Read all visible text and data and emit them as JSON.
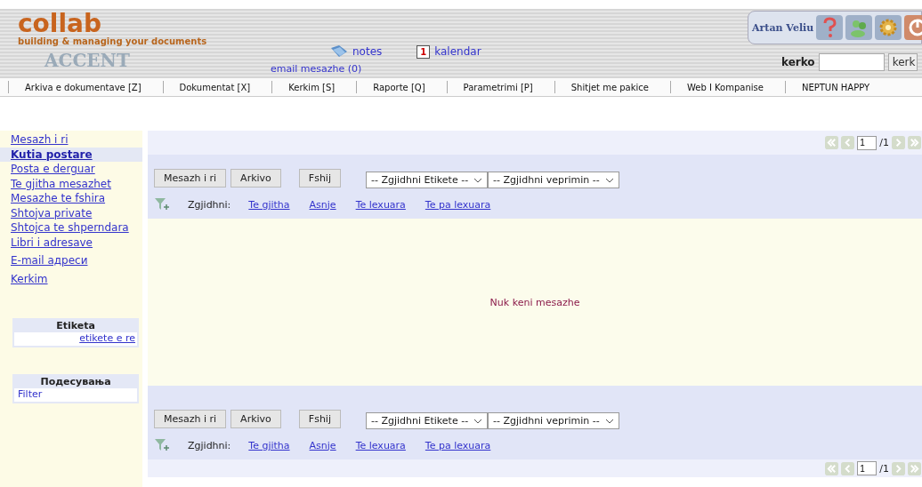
{
  "header": {
    "logo": {
      "name": "collab",
      "tagline": "building & managing your documents",
      "brand": "ACCENT"
    },
    "email_link": "email mesazhe (0)",
    "notes_link": "notes",
    "calendar_link": "kalendar",
    "calendar_day": "1",
    "user": "Artan Veliu",
    "search": {
      "label": "kerko",
      "button": "kerk"
    }
  },
  "menu": [
    "Arkiva e dokumentave [Z]",
    "Dokumentat [X]",
    "Kerkim [S]",
    "Raporte [Q]",
    "Parametrimi [P]",
    "Shitjet me pakice",
    "Web I Kompanise",
    "NEPTUN HAPPY"
  ],
  "sidebar": {
    "items": [
      {
        "label": "Mesazh i ri",
        "selected": false
      },
      {
        "label": "Kutia postare",
        "selected": true
      },
      {
        "label": "Posta e derguar",
        "selected": false
      },
      {
        "label": "Te gjitha mesazhet",
        "selected": false
      },
      {
        "label": "Mesazhe te fshira",
        "selected": false
      },
      {
        "label": "Shtojva private",
        "selected": false
      },
      {
        "label": "Shtojca te shperndara",
        "selected": false
      },
      {
        "label": "Libri i adresave",
        "selected": false
      }
    ],
    "extra_items": [
      "E-mail адреси",
      "Kerkim"
    ],
    "panels": [
      {
        "title": "Etiketa",
        "link": "etikete e re"
      },
      {
        "title": "Подесувања",
        "link": "Filter"
      }
    ]
  },
  "pagers": [
    {
      "page": "1",
      "total": "/1"
    },
    {
      "page": "1",
      "total": "/1"
    }
  ],
  "toolbars": [
    {
      "buttons": [
        "Mesazh i ri",
        "Arkivo",
        "Fshij"
      ],
      "selects": [
        "-- Zgjidhni Etikete --",
        "-- Zgjidhni veprimin --"
      ],
      "select_label": "Zgjidhni:",
      "links": [
        "Te gjitha",
        "Asnje",
        "Te lexuara",
        "Te pa lexuara"
      ]
    },
    {
      "buttons": [
        "Mesazh i ri",
        "Arkivo",
        "Fshij"
      ],
      "selects": [
        "-- Zgjidhni Etikete --",
        "-- Zgjidhni veprimin --"
      ],
      "select_label": "Zgjidhni:",
      "links": [
        "Te gjitha",
        "Asnje",
        "Te lexuara",
        "Te pa lexuara"
      ]
    }
  ],
  "empty_message": "Nuk keni mesazhe"
}
